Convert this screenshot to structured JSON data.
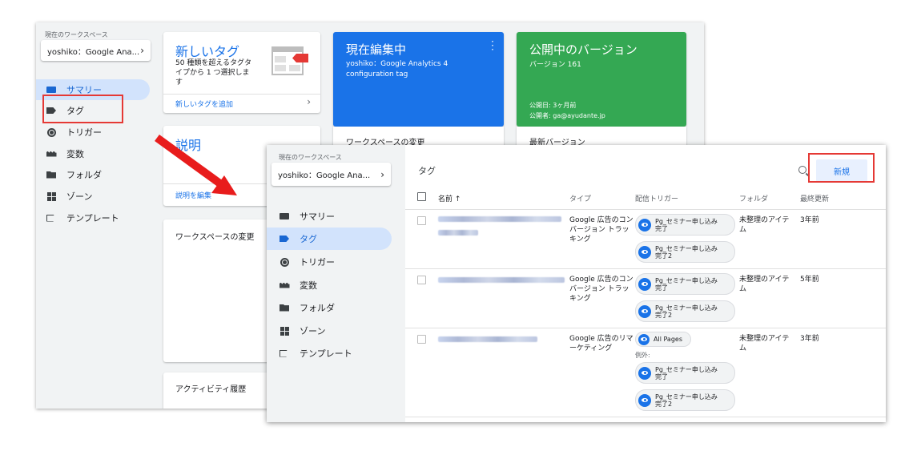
{
  "colors": {
    "accent_blue": "#1a73e8",
    "green": "#34a853",
    "highlight_red": "#e53935",
    "nav_active_bg": "#d2e3fc"
  },
  "bg_window": {
    "workspace_label": "現在のワークスペース",
    "workspace_name": "yoshiko：Google Ana...",
    "nav": [
      {
        "label": "サマリー",
        "icon": "summary-icon"
      },
      {
        "label": "タグ",
        "icon": "tag-icon"
      },
      {
        "label": "トリガー",
        "icon": "trigger-icon"
      },
      {
        "label": "変数",
        "icon": "variable-icon"
      },
      {
        "label": "フォルダ",
        "icon": "folder-icon"
      },
      {
        "label": "ゾーン",
        "icon": "zone-icon"
      },
      {
        "label": "テンプレート",
        "icon": "template-icon"
      }
    ],
    "new_tag_card": {
      "title": "新しいタグ",
      "desc_line1": "50 種類を超えるタグタ",
      "desc_line2": "イプから 1 つ選択しま",
      "desc_line3": "す",
      "link": "新しいタグを追加"
    },
    "editing_card": {
      "title": "現在編集中",
      "line1": "yoshiko：Google Analytics 4",
      "line2": "configuration tag",
      "footer": "ワークスペースの変更"
    },
    "published_card": {
      "title": "公開中のバージョン",
      "version": "バージョン 161",
      "published_date": "公開日: 3ヶ月前",
      "publisher": "公開者: ga@ayudante.jp",
      "footer": "最新バージョン"
    },
    "description_card": {
      "title": "説明",
      "link": "説明を編集"
    },
    "workspace_changes_title": "ワークスペースの変更",
    "activity_title": "アクティビティ履歴"
  },
  "fg_window": {
    "workspace_label": "現在のワークスペース",
    "workspace_name": "yoshiko：Google Ana...",
    "nav": [
      {
        "label": "サマリー",
        "icon": "summary-icon"
      },
      {
        "label": "タグ",
        "icon": "tag-icon"
      },
      {
        "label": "トリガー",
        "icon": "trigger-icon"
      },
      {
        "label": "変数",
        "icon": "variable-icon"
      },
      {
        "label": "フォルダ",
        "icon": "folder-icon"
      },
      {
        "label": "ゾーン",
        "icon": "zone-icon"
      },
      {
        "label": "テンプレート",
        "icon": "template-icon"
      }
    ],
    "panel_title": "タグ",
    "new_button": "新規",
    "columns": {
      "name": "名前 ↑",
      "type": "タイプ",
      "trigger": "配信トリガー",
      "folder": "フォルダ",
      "updated": "最終更新"
    },
    "rows": [
      {
        "type_l1": "Google 広告のコン",
        "type_l2": "バージョン トラッ",
        "type_l3": "キング",
        "triggers": [
          {
            "l1": "Pg_セミナー申し込み",
            "l2": "完了"
          },
          {
            "l1": "Pg_セミナー申し込み",
            "l2": "完了2"
          }
        ],
        "folder_l1": "未整理のアイテ",
        "folder_l2": "ム",
        "updated": "3年前"
      },
      {
        "type_l1": "Google 広告のコン",
        "type_l2": "バージョン トラッ",
        "type_l3": "キング",
        "triggers": [
          {
            "l1": "Pg_セミナー申し込み",
            "l2": "完了"
          },
          {
            "l1": "Pg_セミナー申し込み",
            "l2": "完了2"
          }
        ],
        "folder_l1": "未整理のアイテ",
        "folder_l2": "ム",
        "updated": "5年前"
      },
      {
        "type_l1": "Google 広告のリマ",
        "type_l2": "ーケティング",
        "trigger_main": "All Pages",
        "exclude_label": "例外:",
        "exceptions": [
          {
            "l1": "Pg_セミナー申し込み",
            "l2": "完了"
          },
          {
            "l1": "Pg_セミナー申し込み",
            "l2": "完了2"
          }
        ],
        "folder_l1": "未整理のアイテ",
        "folder_l2": "ム",
        "updated": "3年前"
      }
    ]
  }
}
